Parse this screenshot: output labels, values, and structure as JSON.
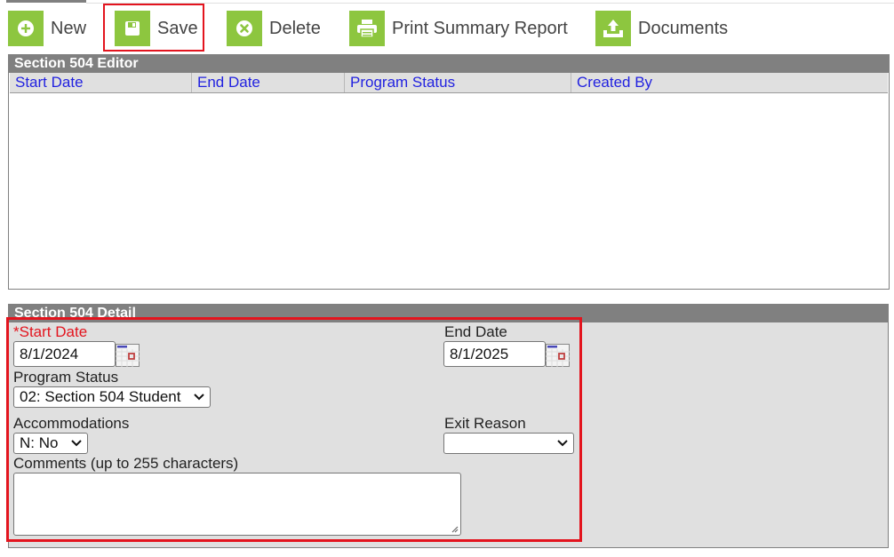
{
  "toolbar": {
    "buttons": [
      {
        "label": "New",
        "icon": "plus-circle-icon"
      },
      {
        "label": "Save",
        "icon": "floppy-disk-icon"
      },
      {
        "label": "Delete",
        "icon": "x-circle-icon"
      },
      {
        "label": "Print Summary Report",
        "icon": "printer-icon"
      },
      {
        "label": "Documents",
        "icon": "upload-tray-icon"
      }
    ],
    "accent_color": "#8dc63f"
  },
  "editor": {
    "title": "Section 504 Editor",
    "columns": [
      "Start Date",
      "End Date",
      "Program Status",
      "Created By"
    ],
    "rows": []
  },
  "detail": {
    "title": "Section 504 Detail",
    "start_date": {
      "label": "*Start Date",
      "value": "8/1/2024",
      "required": true
    },
    "end_date": {
      "label": "End Date",
      "value": "8/1/2025"
    },
    "program_status": {
      "label": "Program Status",
      "value": "02: Section 504 Student"
    },
    "accommodations": {
      "label": "Accommodations",
      "value": "N: No"
    },
    "exit_reason": {
      "label": "Exit Reason",
      "value": ""
    },
    "comments": {
      "label": "Comments (up to 255 characters)",
      "value": ""
    }
  },
  "highlight_color": "#e3141e"
}
